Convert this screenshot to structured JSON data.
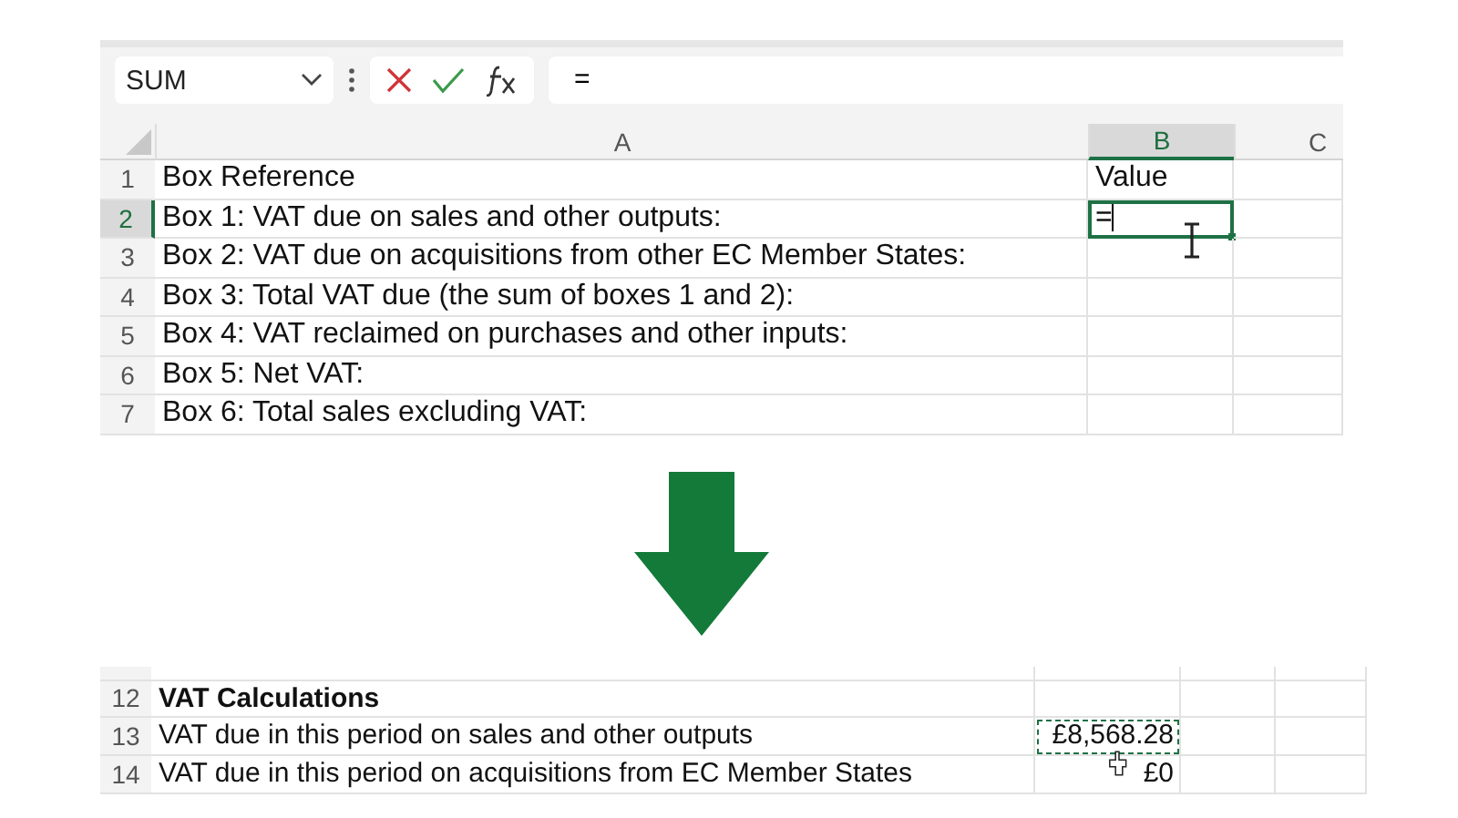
{
  "top": {
    "name_box": "SUM",
    "formula": "=",
    "columns": [
      {
        "label": "A",
        "selected": false
      },
      {
        "label": "B",
        "selected": true
      },
      {
        "label": "C",
        "selected": false
      }
    ],
    "rows": [
      {
        "number": "1",
        "selected": false,
        "a": "Box Reference",
        "b": "Value",
        "editing": false
      },
      {
        "number": "2",
        "selected": true,
        "a": "Box 1: VAT due on sales and other outputs:",
        "b": "=",
        "editing": true
      },
      {
        "number": "3",
        "selected": false,
        "a": "Box 2: VAT due on acquisitions from other EC Member States:",
        "editing": false
      },
      {
        "number": "4",
        "selected": false,
        "a": "Box 3: Total VAT due (the sum of boxes 1 and 2):",
        "editing": false
      },
      {
        "number": "5",
        "selected": false,
        "a": "Box 4: VAT reclaimed on purchases and other inputs:",
        "editing": false
      },
      {
        "number": "6",
        "selected": false,
        "a": "Box 5: Net VAT:",
        "editing": false
      },
      {
        "number": "7",
        "selected": false,
        "a": "Box 6: Total sales excluding VAT:",
        "editing": false
      }
    ]
  },
  "bottom": {
    "rows": [
      {
        "number": "12",
        "kind": "heading",
        "a": "VAT Calculations",
        "copied": false
      },
      {
        "number": "13",
        "kind": "data",
        "a": "VAT due in this period on sales and other outputs",
        "b": "£8,568.28",
        "copied": true
      },
      {
        "number": "14",
        "kind": "data",
        "a": "VAT due in this period on acquisitions from EC Member States",
        "b": "£0",
        "copied": false
      }
    ]
  }
}
